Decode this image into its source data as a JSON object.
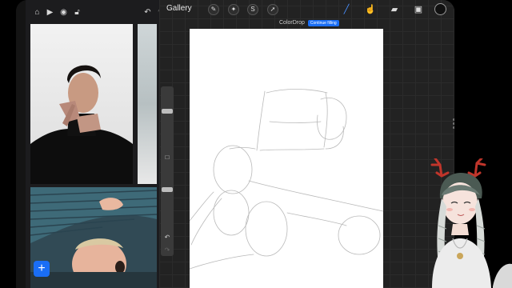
{
  "app": {
    "gallery_label": "Gallery",
    "colordrop_label": "ColorDrop",
    "continue_filling_label": "Continue filling"
  },
  "reference_panel": {
    "add_button_label": "+"
  },
  "colors": {
    "accent": "#1a6ef5",
    "canvas_bg": "#222222",
    "paper": "#ffffff",
    "current_color": "#111111"
  }
}
